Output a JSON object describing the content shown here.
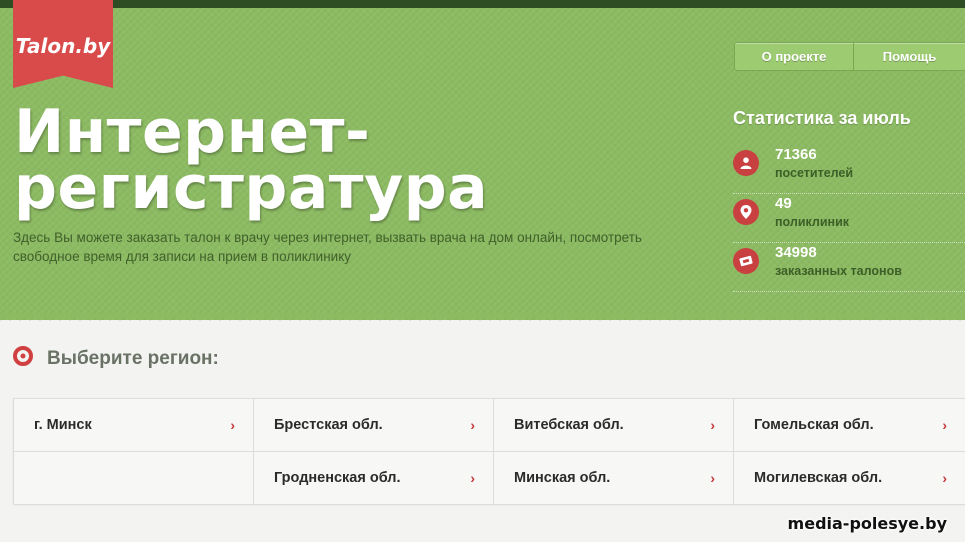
{
  "logo": {
    "text": "Talon.by"
  },
  "nav": {
    "about": "О проекте",
    "help": "Помощь"
  },
  "hero": {
    "title_line1": "Интернет-",
    "title_line2": "регистратура",
    "subtitle_line1": "Здесь Вы можете заказать талон к врачу через интернет, вызвать врача на дом онлайн, посмотреть",
    "subtitle_line2": "свободное время для записи на прием в поликлинику"
  },
  "stats": {
    "title": "Статистика за июль",
    "items": [
      {
        "icon": "person-icon",
        "value": "71366",
        "label": "посетителей"
      },
      {
        "icon": "location-pin-icon",
        "value": "49",
        "label": "поликлиник"
      },
      {
        "icon": "ticket-icon",
        "value": "34998",
        "label": "заказанных талонов"
      }
    ]
  },
  "regions": {
    "title": "Выберите регион:",
    "items": [
      "г. Минск",
      "Брестская обл.",
      "Витебская обл.",
      "Гомельская обл.",
      "Гродненская обл.",
      "Минская обл.",
      "Могилевская обл."
    ],
    "chevron": "›"
  },
  "watermark": "media-polesye.by",
  "colors": {
    "hero_green": "#8cbb62",
    "accent_red": "#d94b4b",
    "dark_bar": "#2e4d22"
  }
}
